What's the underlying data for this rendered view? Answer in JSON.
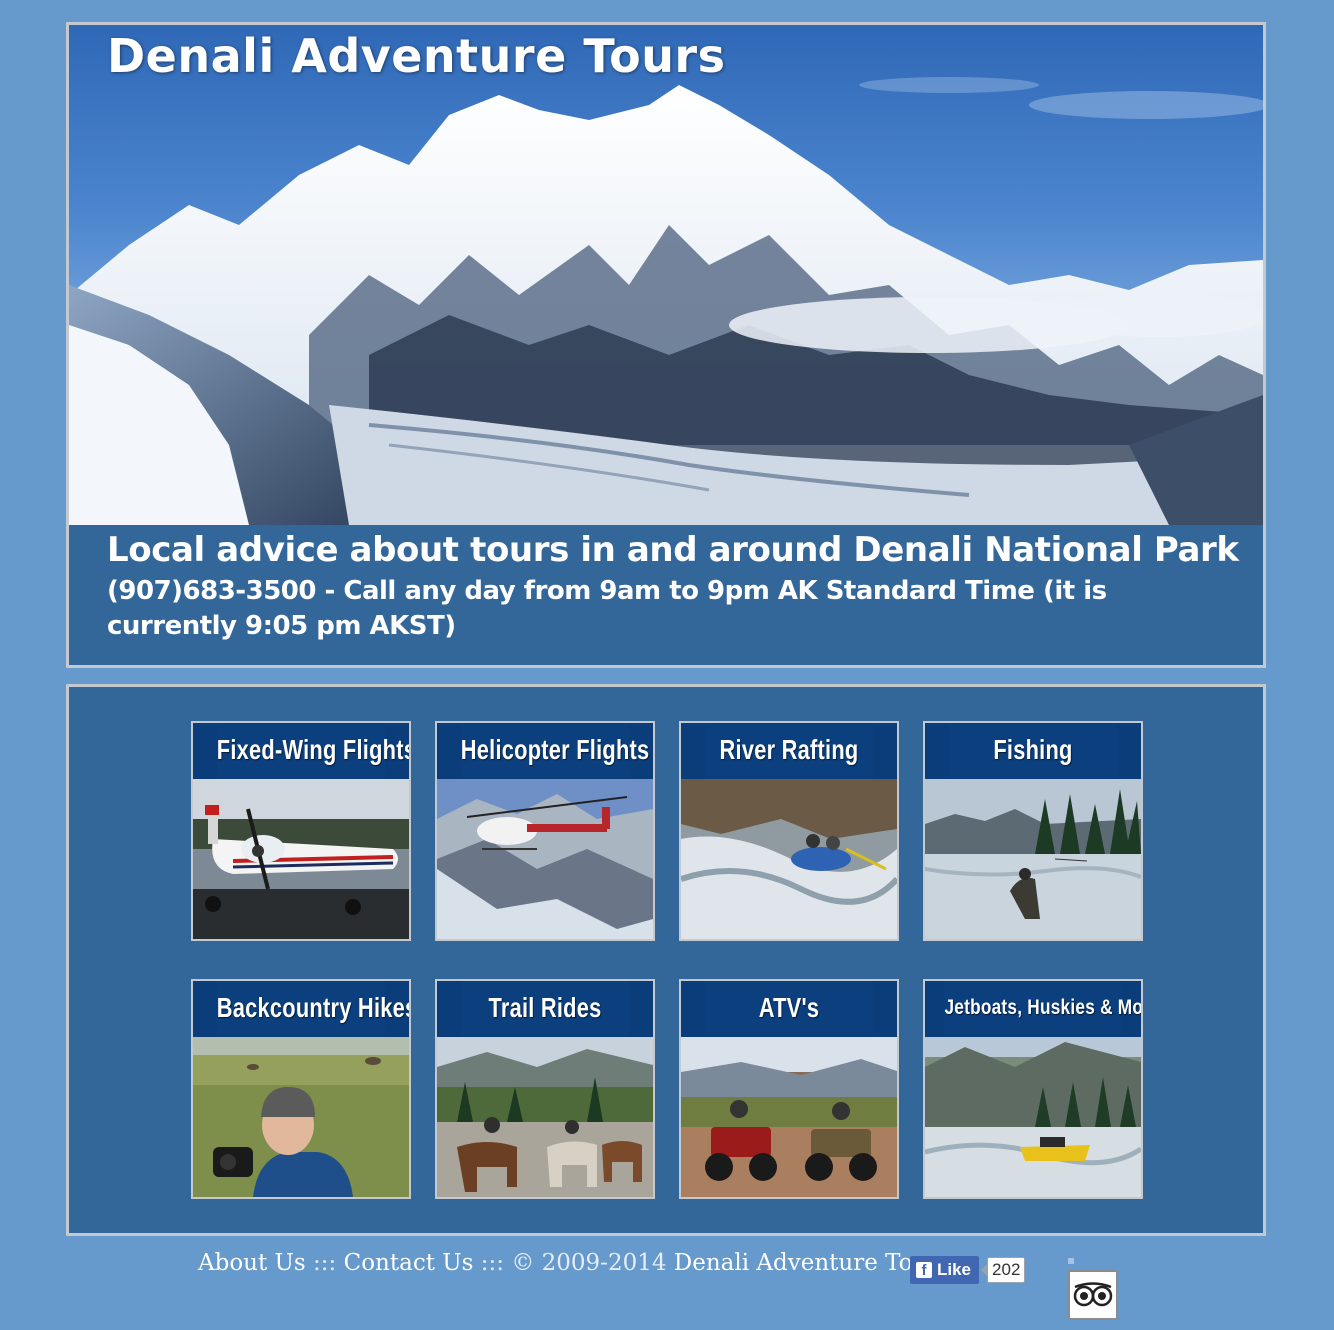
{
  "header": {
    "title": "Denali Adventure Tours",
    "tagline": "Local advice about tours in and around Denali National Park",
    "phone_line": "(907)683-3500 - Call any day from 9am to 9pm AK Standard Time (it is currently 9:05 pm AKST)"
  },
  "tours": [
    {
      "label": "Fixed-Wing Flights",
      "icon": "airplane-photo"
    },
    {
      "label": "Helicopter Flights",
      "icon": "helicopter-photo"
    },
    {
      "label": "River Rafting",
      "icon": "rafting-photo"
    },
    {
      "label": "Fishing",
      "icon": "fishing-photo"
    },
    {
      "label": "Backcountry Hikes",
      "icon": "hiker-photo"
    },
    {
      "label": "Trail Rides",
      "icon": "horses-photo"
    },
    {
      "label": "ATV's",
      "icon": "atv-photo"
    },
    {
      "label": "Jetboats, Huskies & More",
      "icon": "jetboat-photo"
    }
  ],
  "footer": {
    "about": "About Us",
    "sep1": " ::: ",
    "contact": "Contact Us",
    "sep2": " ::: ",
    "copyright": "© 2009-2014",
    "company": " Denali Adventure Tours",
    "fb_like": "Like",
    "fb_count": "202"
  },
  "colors": {
    "page_bg": "#6699cc",
    "panel_bg": "#336699",
    "tile_header": "#0c3f7e",
    "border": "#c4c9cf"
  }
}
